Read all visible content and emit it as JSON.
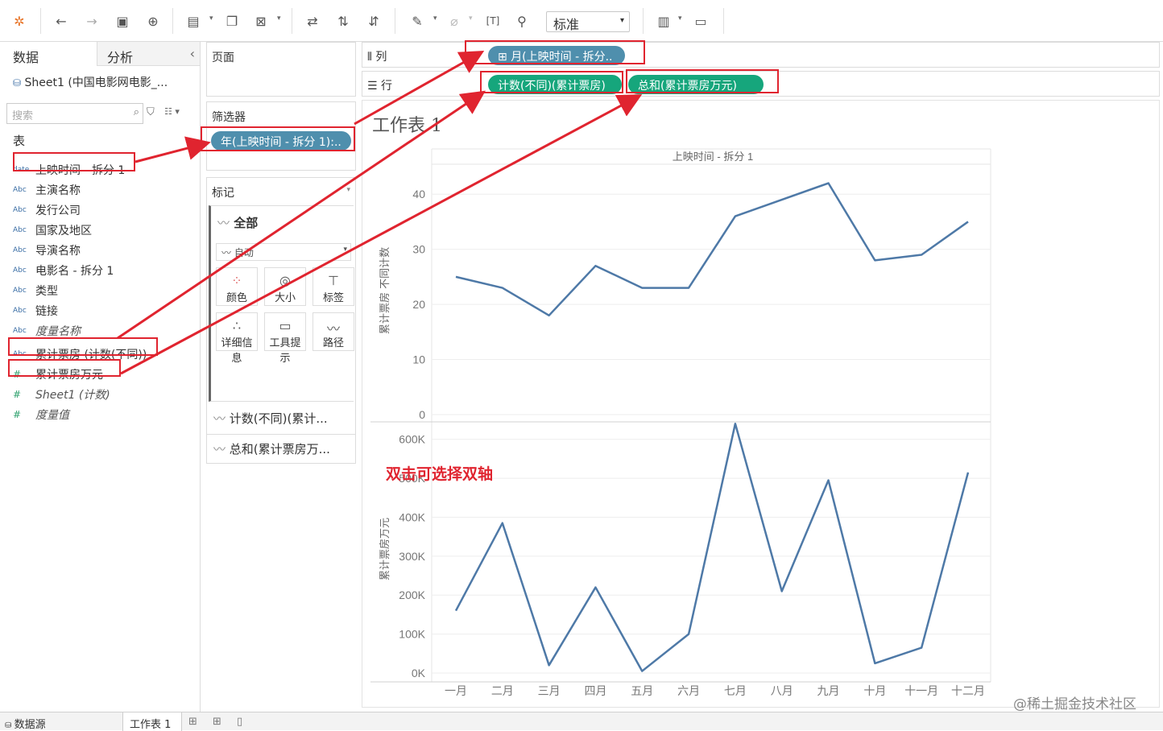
{
  "toolbar": {
    "fit_label": "标准",
    "icons": [
      "tableau-logo-icon",
      "back-icon",
      "forward-icon",
      "save-icon",
      "add-datasource-icon",
      "new-sheet-icon",
      "duplicate-icon",
      "clear-sheet-icon",
      "swap-axes-icon",
      "sort-asc-icon",
      "sort-desc-icon",
      "highlight-icon",
      "group-icon",
      "label-icon",
      "pin-icon",
      "show-me-icon",
      "presentation-icon"
    ]
  },
  "left_pane": {
    "tab_data": "数据",
    "tab_analysis": "分析",
    "collapse": "‹",
    "datasource": "Sheet1 (中国电影网电影_...",
    "search_placeholder": "搜索",
    "section": "表",
    "fields": [
      {
        "type": "date",
        "name": "上映时间 - 拆分 1"
      },
      {
        "type": "Abc",
        "name": "主演名称"
      },
      {
        "type": "Abc",
        "name": "发行公司"
      },
      {
        "type": "Abc",
        "name": "国家及地区"
      },
      {
        "type": "Abc",
        "name": "导演名称"
      },
      {
        "type": "Abc",
        "name": "电影名 - 拆分 1"
      },
      {
        "type": "Abc",
        "name": "类型"
      },
      {
        "type": "Abc",
        "name": "链接"
      },
      {
        "type": "Abc",
        "name": "度量名称",
        "italic": true
      },
      {
        "type": "Abc",
        "name": "累计票房 (计数(不同))"
      },
      {
        "type": "#",
        "name": "累计票房万元"
      },
      {
        "type": "#",
        "name": "Sheet1 (计数)",
        "italic": true
      },
      {
        "type": "#",
        "name": "度量值",
        "italic": true
      }
    ]
  },
  "pages_card": {
    "title": "页面"
  },
  "filters_card": {
    "title": "筛选器",
    "pill": "年(上映时间 - 拆分 1):.."
  },
  "marks_card": {
    "title": "标记",
    "all_label": "全部",
    "mark_type": "自动",
    "buttons": [
      "颜色",
      "大小",
      "标签",
      "详细信息",
      "工具提示",
      "路径"
    ],
    "measure_rows": [
      "计数(不同)(累计...",
      "总和(累计票房万..."
    ]
  },
  "shelves": {
    "columns_label": "列",
    "rows_label": "行",
    "columns_pill": "月(上映时间 - 拆分..",
    "rows_pill_1": "计数(不同)(累计票房)",
    "rows_pill_2": "总和(累计票房万元)"
  },
  "sheet": {
    "title": "工作表 1",
    "header": "上映时间 - 拆分 1",
    "y1_label": "累计票房 不同计数",
    "y2_label": "累计票房万元",
    "annotation": "双击可选择双轴"
  },
  "chart_data": [
    {
      "type": "line",
      "categories": [
        "一月",
        "二月",
        "三月",
        "四月",
        "五月",
        "六月",
        "七月",
        "八月",
        "九月",
        "十月",
        "十一月",
        "十二月"
      ],
      "series": [
        {
          "values": [
            25,
            23,
            18,
            27,
            23,
            23,
            36,
            39,
            42,
            28,
            29,
            35
          ]
        }
      ],
      "ylabel": "累计票房 不同计数",
      "yticks": [
        "0",
        "10",
        "20",
        "30",
        "40"
      ],
      "ylim": [
        0,
        45
      ],
      "color": "#4e79a7"
    },
    {
      "type": "line",
      "categories": [
        "一月",
        "二月",
        "三月",
        "四月",
        "五月",
        "六月",
        "七月",
        "八月",
        "九月",
        "十月",
        "十一月",
        "十二月"
      ],
      "series": [
        {
          "values": [
            160000,
            385000,
            20000,
            220000,
            5000,
            100000,
            640000,
            210000,
            495000,
            25000,
            65000,
            515000
          ]
        }
      ],
      "ylabel": "累计票房万元",
      "yticks": [
        "0K",
        "100K",
        "200K",
        "300K",
        "400K",
        "500K",
        "600K"
      ],
      "ylim": [
        0,
        620000
      ],
      "color": "#4e79a7"
    }
  ],
  "bottom_bar": {
    "datasource_tab": "数据源",
    "sheet_tab": "工作表 1"
  },
  "watermark": "@稀土掘金技术社区"
}
